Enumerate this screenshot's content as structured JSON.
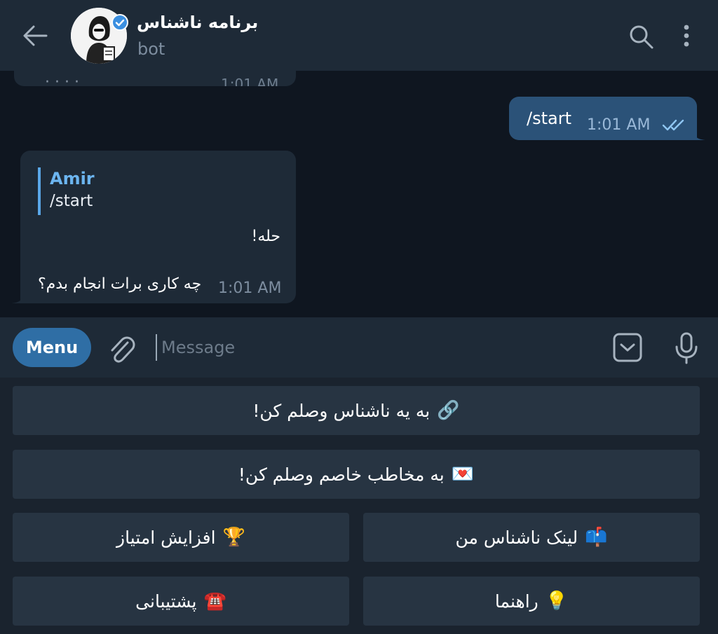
{
  "header": {
    "title": "برنامه ناشناس",
    "subtitle": "bot",
    "icons": [
      "back-arrow-icon",
      "avatar",
      "verified-badge-icon",
      "search-icon",
      "more-vertical-icon"
    ]
  },
  "chat": {
    "previous_message": {
      "time": "1:01 AM"
    },
    "outgoing": {
      "text": "/start",
      "time": "1:01 AM",
      "status": "read"
    },
    "incoming": {
      "reply_to_name": "Amir",
      "reply_to_text": "/start",
      "line1": "حله!",
      "line2": "چه کاری برات انجام بدم؟",
      "time": "1:01 AM"
    }
  },
  "composer": {
    "menu_label": "Menu",
    "placeholder": "Message"
  },
  "keyboard": {
    "buttons": [
      {
        "emoji": "🔗",
        "label": "به یه ناشناس وصلم کن!"
      },
      {
        "emoji": "💌",
        "label": "به مخاطب خاصم وصلم کن!"
      },
      {
        "emoji": "🏆",
        "label": "افزایش امتیاز"
      },
      {
        "emoji": "📫",
        "label": "لینک ناشناس من"
      },
      {
        "emoji": "☎️",
        "label": "پشتیبانی"
      },
      {
        "emoji": "💡",
        "label": "راهنما"
      }
    ]
  },
  "colors": {
    "background": "#0f1620",
    "header": "#1e2a37",
    "outgoing_bubble": "#2b5278",
    "incoming_bubble": "#1e2a37",
    "accent": "#2f6ea5",
    "link": "#6cb5f0",
    "keyboard_button": "#273442"
  }
}
